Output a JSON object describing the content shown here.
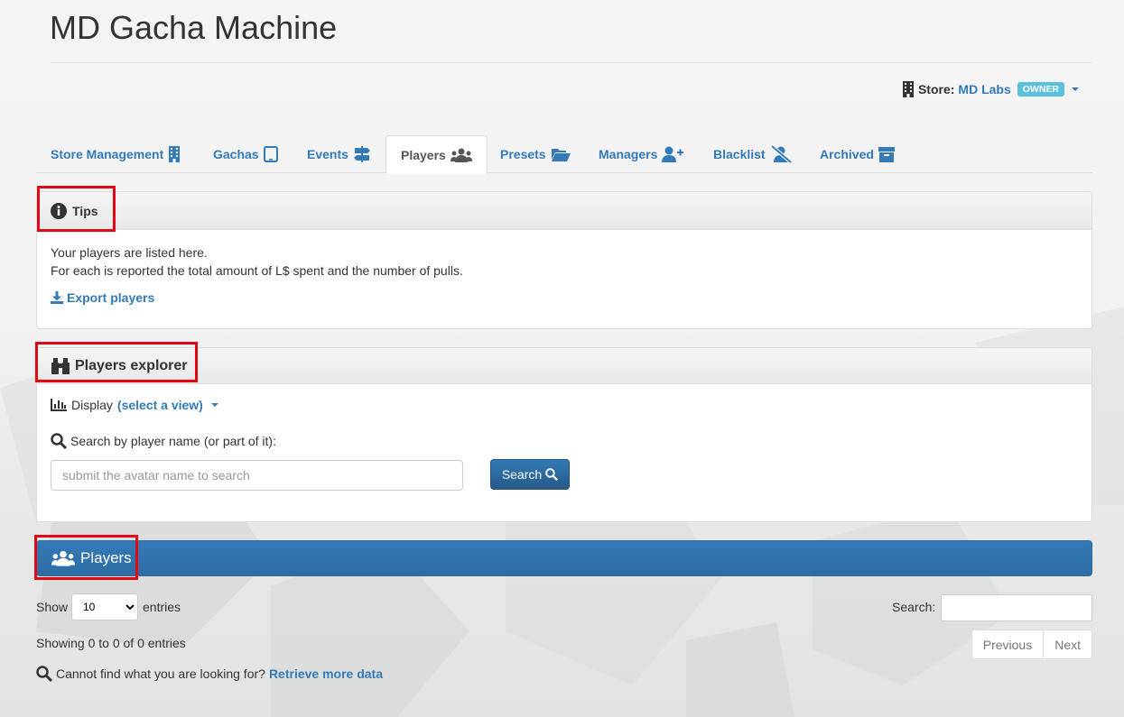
{
  "app": {
    "title": "MD Gacha Machine"
  },
  "store": {
    "label": "Store:",
    "name": "MD Labs",
    "role_badge": "OWNER"
  },
  "tabs": [
    {
      "label": "Store Management",
      "icon": "building-icon"
    },
    {
      "label": "Gachas",
      "icon": "tablet-icon"
    },
    {
      "label": "Events",
      "icon": "signpost-icon"
    },
    {
      "label": "Players",
      "icon": "users-icon",
      "active": true
    },
    {
      "label": "Presets",
      "icon": "folder-open-icon"
    },
    {
      "label": "Managers",
      "icon": "user-plus-icon"
    },
    {
      "label": "Blacklist",
      "icon": "user-slash-icon"
    },
    {
      "label": "Archived",
      "icon": "archive-icon"
    }
  ],
  "tips": {
    "heading": "Tips",
    "line1": "Your players are listed here.",
    "line2": "For each is reported the total amount of L$ spent and the number of pulls.",
    "export_label": "Export players"
  },
  "explorer": {
    "heading": "Players explorer",
    "display_label": "Display",
    "view_select_label": "(select a view)",
    "search_label": "Search by player name (or part of it):",
    "search_placeholder": "submit the avatar name to search",
    "search_button": "Search"
  },
  "players_panel": {
    "heading": "Players",
    "show_label": "Show",
    "entries_label": "entries",
    "page_length": "10",
    "search_label": "Search:",
    "info": "Showing 0 to 0 of 0 entries",
    "previous": "Previous",
    "next": "Next",
    "cannot_find": "Cannot find what you are looking for?",
    "retrieve_label": "Retrieve more data"
  },
  "colors": {
    "accent": "#337ab7",
    "highlight_box": "#e30613",
    "badge": "#5bc0de"
  }
}
